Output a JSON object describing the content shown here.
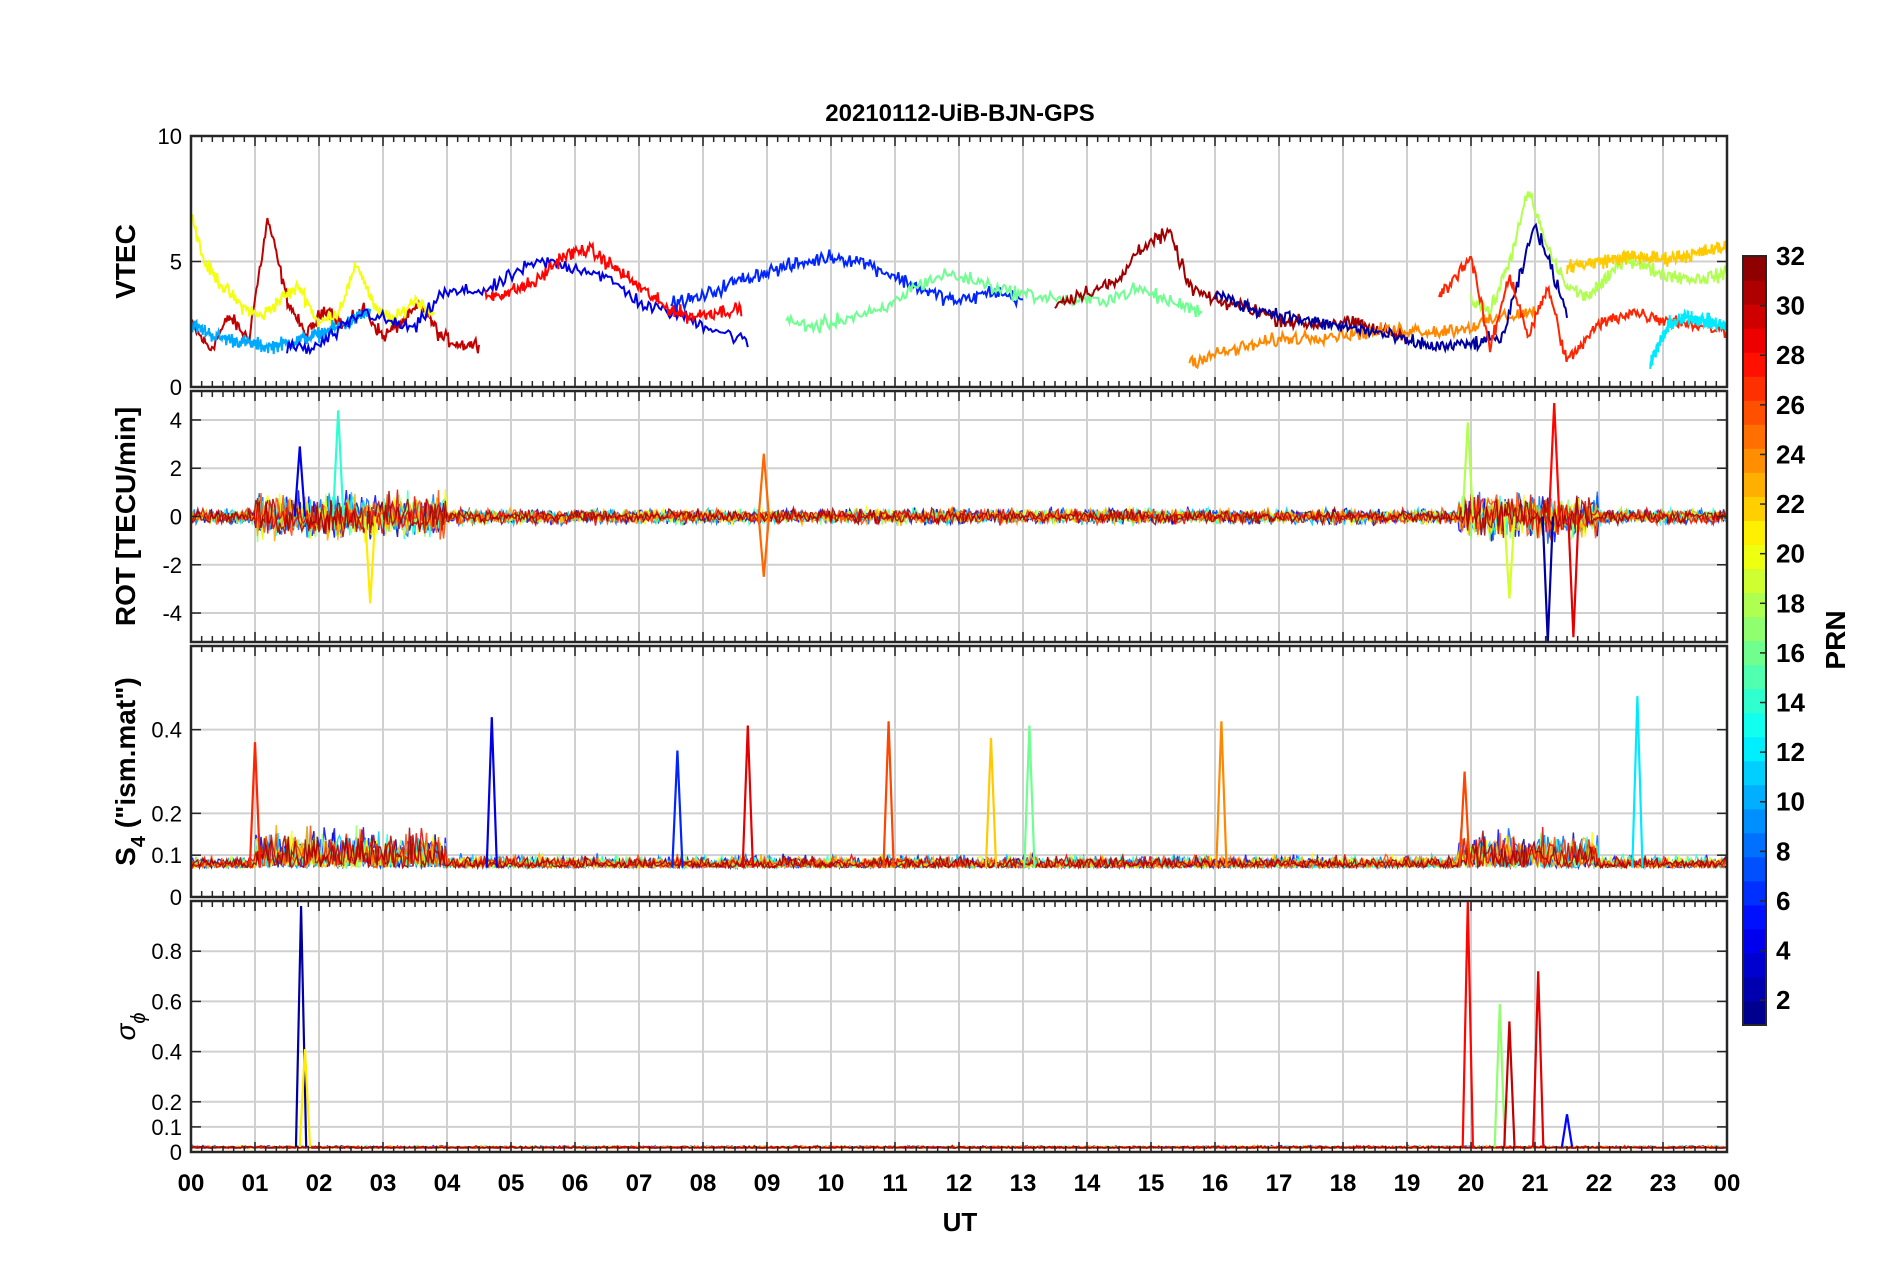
{
  "title": "20210112-UiB-BJN-GPS",
  "x_axis": {
    "label": "UT",
    "tick_labels": [
      "00",
      "01",
      "02",
      "03",
      "04",
      "05",
      "06",
      "07",
      "08",
      "09",
      "10",
      "11",
      "12",
      "13",
      "14",
      "15",
      "16",
      "17",
      "18",
      "19",
      "20",
      "21",
      "22",
      "23",
      "00"
    ]
  },
  "colorbar": {
    "label": "PRN",
    "range": [
      1,
      32
    ],
    "tick_values": [
      2,
      4,
      6,
      8,
      10,
      12,
      14,
      16,
      18,
      20,
      22,
      24,
      26,
      28,
      30,
      32
    ],
    "tick_labels": [
      "2",
      "4",
      "6",
      "8",
      "10",
      "12",
      "14",
      "16",
      "18",
      "20",
      "22",
      "24",
      "26",
      "28",
      "30",
      "32"
    ]
  },
  "colors": {
    "axis": "#262626",
    "grid": "#d0d0d0",
    "background": "#ffffff"
  },
  "panels": [
    {
      "id": "vtec",
      "ylabel": "VTEC",
      "ylim": [
        0,
        10
      ],
      "tick_values": [
        0,
        5,
        10
      ],
      "tick_labels": [
        "0",
        "5",
        "10"
      ]
    },
    {
      "id": "rot",
      "ylabel": "ROT [TECU/min]",
      "ylim": [
        -5.2,
        5.2
      ],
      "tick_values": [
        -4,
        -2,
        0,
        2,
        4
      ],
      "tick_labels": [
        "-4",
        "-2",
        "0",
        "2",
        "4"
      ]
    },
    {
      "id": "s4",
      "ylabel_main": "S",
      "ylabel_sub": "4",
      "ylabel_rest": " (\"ism.mat\")",
      "ylim": [
        0,
        0.6
      ],
      "tick_values": [
        0,
        0.1,
        0.2,
        0.4
      ],
      "tick_labels": [
        "0",
        "0.1",
        "0.2",
        "0.4"
      ]
    },
    {
      "id": "sigphi",
      "ylabel_main": "σ",
      "ylabel_sub": "ϕ",
      "ylim": [
        0,
        1
      ],
      "tick_values": [
        0,
        0.1,
        0.2,
        0.4,
        0.6,
        0.8
      ],
      "tick_labels": [
        "0",
        "0.1",
        "0.2",
        "0.4",
        "0.6",
        "0.8"
      ]
    }
  ],
  "chart_data": {
    "type": "line",
    "title": "20210112-UiB-BJN-GPS",
    "xlabel": "UT",
    "xlim": [
      0,
      24
    ],
    "color_variable": "PRN",
    "color_range": [
      1,
      32
    ],
    "subplots": [
      {
        "ylabel": "VTEC",
        "ylim": [
          0,
          10
        ],
        "series": [
          {
            "prn": 30,
            "x": [
              0,
              0.3,
              0.6,
              0.9,
              1.2,
              1.5,
              1.8,
              2.1,
              2.4,
              2.7,
              3.0,
              3.3,
              3.6,
              3.9,
              4.2,
              4.5
            ],
            "y": [
              2.5,
              1.5,
              2.8,
              1.9,
              6.7,
              3.5,
              2.0,
              3.2,
              2.4,
              3.1,
              2.0,
              2.6,
              3.3,
              2.0,
              1.7,
              1.7
            ]
          },
          {
            "prn": 20,
            "x": [
              0,
              0.2,
              0.5,
              0.8,
              1.1,
              1.4,
              1.7,
              2.0,
              2.3,
              2.6,
              2.9,
              3.2,
              3.5,
              3.8
            ],
            "y": [
              7.0,
              5.0,
              4.0,
              3.2,
              2.8,
              3.5,
              4.0,
              2.5,
              3.0,
              4.9,
              3.0,
              2.7,
              3.5,
              2.9
            ]
          },
          {
            "prn": 10,
            "x": [
              0,
              0.4,
              0.8,
              1.2,
              1.6,
              2.0,
              2.4,
              2.8
            ],
            "y": [
              2.5,
              2.0,
              1.8,
              1.6,
              1.8,
              2.1,
              2.5,
              3.0
            ]
          },
          {
            "prn": 4,
            "x": [
              1.5,
              1.9,
              2.3,
              2.7,
              3.1,
              3.5,
              3.9,
              4.3,
              4.7,
              5.1,
              5.5,
              5.9,
              6.3,
              6.7,
              7.1,
              7.5,
              7.9,
              8.3,
              8.7
            ],
            "y": [
              1.6,
              1.5,
              2.2,
              3.0,
              2.6,
              2.3,
              3.7,
              3.8,
              3.9,
              4.6,
              5.0,
              4.8,
              4.6,
              4.0,
              3.2,
              3.0,
              2.6,
              2.2,
              1.8
            ]
          },
          {
            "prn": 28,
            "x": [
              4.6,
              5.0,
              5.4,
              5.8,
              6.2,
              6.6,
              7.0,
              7.4,
              7.8,
              8.2,
              8.6
            ],
            "y": [
              3.6,
              3.8,
              4.2,
              5.2,
              5.5,
              4.8,
              4.0,
              3.2,
              2.8,
              3.0,
              3.1
            ]
          },
          {
            "prn": 6,
            "x": [
              7.5,
              8.0,
              8.5,
              9.0,
              9.5,
              10.0,
              10.5,
              11.0,
              11.5,
              12.0,
              12.5,
              13.0
            ],
            "y": [
              3.3,
              3.6,
              4.2,
              4.6,
              4.9,
              5.2,
              5.0,
              4.4,
              3.8,
              3.4,
              3.8,
              3.5
            ]
          },
          {
            "prn": 16,
            "x": [
              9.3,
              9.8,
              10.3,
              10.8,
              11.3,
              11.8,
              12.3,
              12.8,
              13.3,
              13.8,
              14.3,
              14.8,
              15.3,
              15.8
            ],
            "y": [
              2.6,
              2.4,
              2.8,
              3.0,
              4.0,
              4.5,
              4.2,
              3.8,
              3.6,
              3.4,
              3.5,
              3.9,
              3.4,
              3.0
            ]
          },
          {
            "prn": 31,
            "x": [
              13.5,
              14.0,
              14.5,
              14.8,
              15.0,
              15.3,
              15.6,
              16.0,
              16.5,
              17.0,
              17.5,
              18.0,
              18.5,
              19.0
            ],
            "y": [
              3.3,
              3.8,
              4.2,
              5.5,
              5.8,
              6.1,
              4.0,
              3.4,
              3.2,
              2.7,
              2.5,
              2.6,
              2.3,
              2.0
            ]
          },
          {
            "prn": 24,
            "x": [
              15.6,
              16.0,
              16.5,
              17.0,
              17.5,
              18.0,
              18.5,
              19.0,
              19.5,
              20.0,
              20.5,
              21.0
            ],
            "y": [
              1.0,
              1.3,
              1.6,
              1.9,
              2.0,
              2.1,
              2.2,
              2.3,
              2.2,
              2.4,
              2.8,
              3.0
            ]
          },
          {
            "prn": 2,
            "x": [
              16.0,
              16.5,
              17.0,
              17.5,
              18.0,
              18.5,
              19.0,
              19.5,
              20.0,
              20.5,
              21.0,
              21.5
            ],
            "y": [
              3.7,
              3.2,
              2.9,
              2.6,
              2.4,
              2.2,
              1.8,
              1.6,
              1.7,
              2.0,
              6.5,
              3.0
            ]
          },
          {
            "prn": 18,
            "x": [
              20.0,
              20.3,
              20.6,
              20.9,
              21.2,
              21.5,
              21.8,
              22.1,
              22.4,
              22.7,
              23.0,
              23.5,
              24.0
            ],
            "y": [
              3.5,
              3.0,
              5.0,
              7.8,
              5.5,
              4.0,
              3.6,
              4.2,
              5.2,
              4.8,
              4.5,
              4.3,
              4.5
            ]
          },
          {
            "prn": 22,
            "x": [
              21.5,
              22.0,
              22.5,
              23.0,
              23.5,
              24.0
            ],
            "y": [
              4.8,
              5.0,
              5.2,
              5.1,
              5.3,
              5.6
            ]
          },
          {
            "prn": 27,
            "x": [
              19.5,
              20.0,
              20.3,
              20.6,
              20.9,
              21.2,
              21.5,
              22.0,
              22.5,
              23.0,
              23.5,
              24.0
            ],
            "y": [
              3.6,
              5.2,
              1.5,
              4.5,
              2.0,
              4.0,
              1.0,
              2.5,
              3.0,
              2.7,
              2.5,
              2.2
            ]
          },
          {
            "prn": 12,
            "x": [
              22.8,
              23.1,
              23.4,
              23.7,
              24.0
            ],
            "y": [
              1.0,
              2.5,
              2.8,
              2.6,
              2.4
            ]
          }
        ]
      },
      {
        "ylabel": "ROT [TECU/min]",
        "ylim": [
          -5.2,
          5.2
        ],
        "series_description_points": [
          {
            "prn": 4,
            "x": 1.7,
            "y": 2.9
          },
          {
            "prn": 14,
            "x": 2.3,
            "y": 4.4
          },
          {
            "prn": 21,
            "x": 2.8,
            "y": -3.6
          },
          {
            "prn": 25,
            "x": 8.95,
            "y": 2.6
          },
          {
            "prn": 25,
            "x": 8.95,
            "y": -2.5
          },
          {
            "prn": 18,
            "x": 19.95,
            "y": 3.9
          },
          {
            "prn": 19,
            "x": 20.6,
            "y": -3.4
          },
          {
            "prn": 28,
            "x": 21.3,
            "y": 4.7
          },
          {
            "prn": 2,
            "x": 21.2,
            "y": -5.2
          },
          {
            "prn": 29,
            "x": 21.6,
            "y": -5.0
          }
        ]
      },
      {
        "ylabel": "S4 (\"ism.mat\")",
        "ylim": [
          0,
          0.6
        ],
        "series_description_points": [
          {
            "prn": 27,
            "x": 1.0,
            "y": 0.37
          },
          {
            "prn": 4,
            "x": 4.7,
            "y": 0.43
          },
          {
            "prn": 6,
            "x": 7.6,
            "y": 0.35
          },
          {
            "prn": 29,
            "x": 8.7,
            "y": 0.41
          },
          {
            "prn": 26,
            "x": 10.9,
            "y": 0.42
          },
          {
            "prn": 22,
            "x": 12.5,
            "y": 0.38
          },
          {
            "prn": 16,
            "x": 13.1,
            "y": 0.41
          },
          {
            "prn": 24,
            "x": 16.1,
            "y": 0.42
          },
          {
            "prn": 26,
            "x": 19.9,
            "y": 0.3
          },
          {
            "prn": 12,
            "x": 22.6,
            "y": 0.48
          }
        ]
      },
      {
        "ylabel": "σϕ",
        "ylim": [
          0,
          1
        ],
        "series_description_points": [
          {
            "prn": 2,
            "x": 1.72,
            "y": 0.98
          },
          {
            "prn": 21,
            "x": 1.78,
            "y": 0.41
          },
          {
            "prn": 28,
            "x": 19.95,
            "y": 1.0
          },
          {
            "prn": 17,
            "x": 20.45,
            "y": 0.59
          },
          {
            "prn": 30,
            "x": 20.6,
            "y": 0.52
          },
          {
            "prn": 29,
            "x": 21.05,
            "y": 0.72
          },
          {
            "prn": 5,
            "x": 21.5,
            "y": 0.15
          }
        ]
      }
    ]
  }
}
